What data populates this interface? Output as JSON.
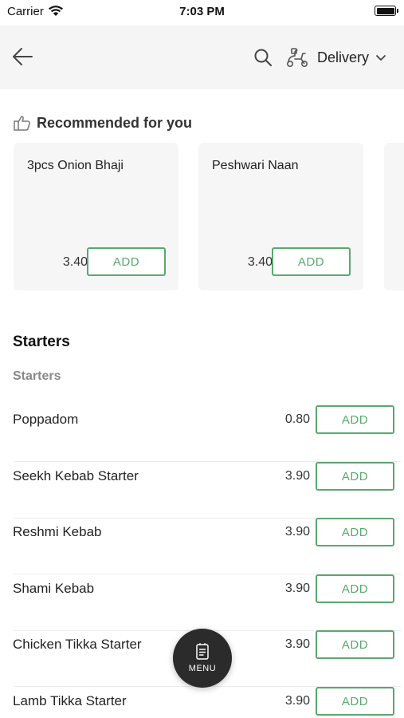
{
  "status_bar": {
    "carrier": "Carrier",
    "time": "7:03 PM"
  },
  "header": {
    "back_icon": "arrow-left-icon",
    "search_icon": "search-icon",
    "delivery_icon": "scooter-icon",
    "delivery_label": "Delivery"
  },
  "recommended": {
    "title": "Recommended for you",
    "items": [
      {
        "name": "3pcs Onion Bhaji",
        "price": "3.40",
        "add_label": "ADD"
      },
      {
        "name": "Peshwari Naan",
        "price": "3.40",
        "add_label": "ADD"
      }
    ]
  },
  "section": {
    "title": "Starters",
    "subtitle": "Starters",
    "items": [
      {
        "name": "Poppadom",
        "price": "0.80",
        "add_label": "ADD"
      },
      {
        "name": "Seekh Kebab Starter",
        "price": "3.90",
        "add_label": "ADD"
      },
      {
        "name": "Reshmi Kebab",
        "price": "3.90",
        "add_label": "ADD"
      },
      {
        "name": "Shami Kebab",
        "price": "3.90",
        "add_label": "ADD"
      },
      {
        "name": "Chicken Tikka Starter",
        "price": "3.90",
        "add_label": "ADD"
      },
      {
        "name": "Lamb Tikka Starter",
        "price": "3.90",
        "add_label": "ADD"
      }
    ]
  },
  "fab": {
    "label": "MENU",
    "icon": "menu-book-icon"
  },
  "colors": {
    "accent": "#5aa86e",
    "header_bg": "#f5f5f5",
    "card_bg": "#f6f6f6",
    "fab_bg": "#2b2b2b"
  }
}
